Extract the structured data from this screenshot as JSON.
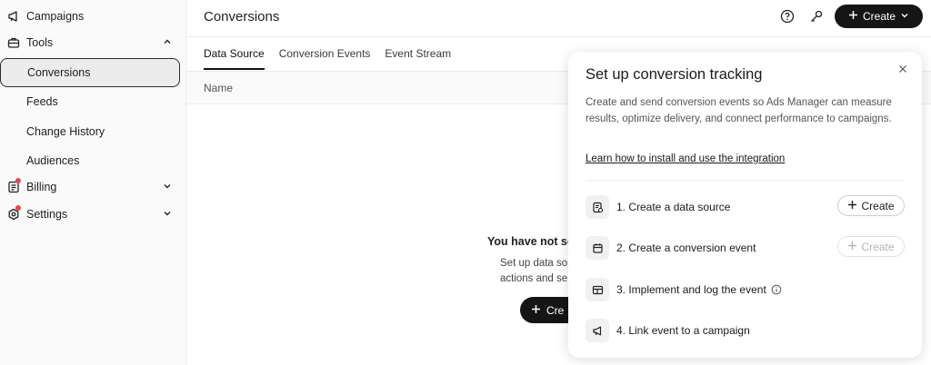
{
  "sidebar": {
    "items": [
      {
        "label": "Campaigns",
        "icon": "megaphone-icon"
      },
      {
        "label": "Tools",
        "icon": "toolbox-icon"
      },
      {
        "label": "Conversions"
      },
      {
        "label": "Feeds"
      },
      {
        "label": "Change History"
      },
      {
        "label": "Audiences"
      },
      {
        "label": "Billing",
        "icon": "receipt-icon"
      },
      {
        "label": "Settings",
        "icon": "gear-icon"
      }
    ]
  },
  "header": {
    "title": "Conversions",
    "create_label": "Create"
  },
  "tabs": [
    {
      "label": "Data Source",
      "active": true
    },
    {
      "label": "Conversion Events",
      "active": false
    },
    {
      "label": "Event Stream",
      "active": false
    }
  ],
  "table": {
    "columns": [
      "Name"
    ]
  },
  "empty_state": {
    "title": "You have not se",
    "desc_line1": "Set up data so",
    "desc_line2": "actions and se",
    "create_label": "Cre"
  },
  "panel": {
    "title": "Set up conversion tracking",
    "description": "Create and send conversion events so Ads Manager can measure results, optimize delivery, and connect performance to campaigns.",
    "link": "Learn how to install and use the integration",
    "steps": [
      {
        "label": "1. Create a data source",
        "button": "Create",
        "enabled": true
      },
      {
        "label": "2. Create a conversion event",
        "button": "Create",
        "enabled": false
      },
      {
        "label": "3. Implement and log the event"
      },
      {
        "label": "4. Link event to a campaign"
      }
    ]
  },
  "colors": {
    "primary_button": "#151515",
    "notification_dot": "#e5484d"
  }
}
